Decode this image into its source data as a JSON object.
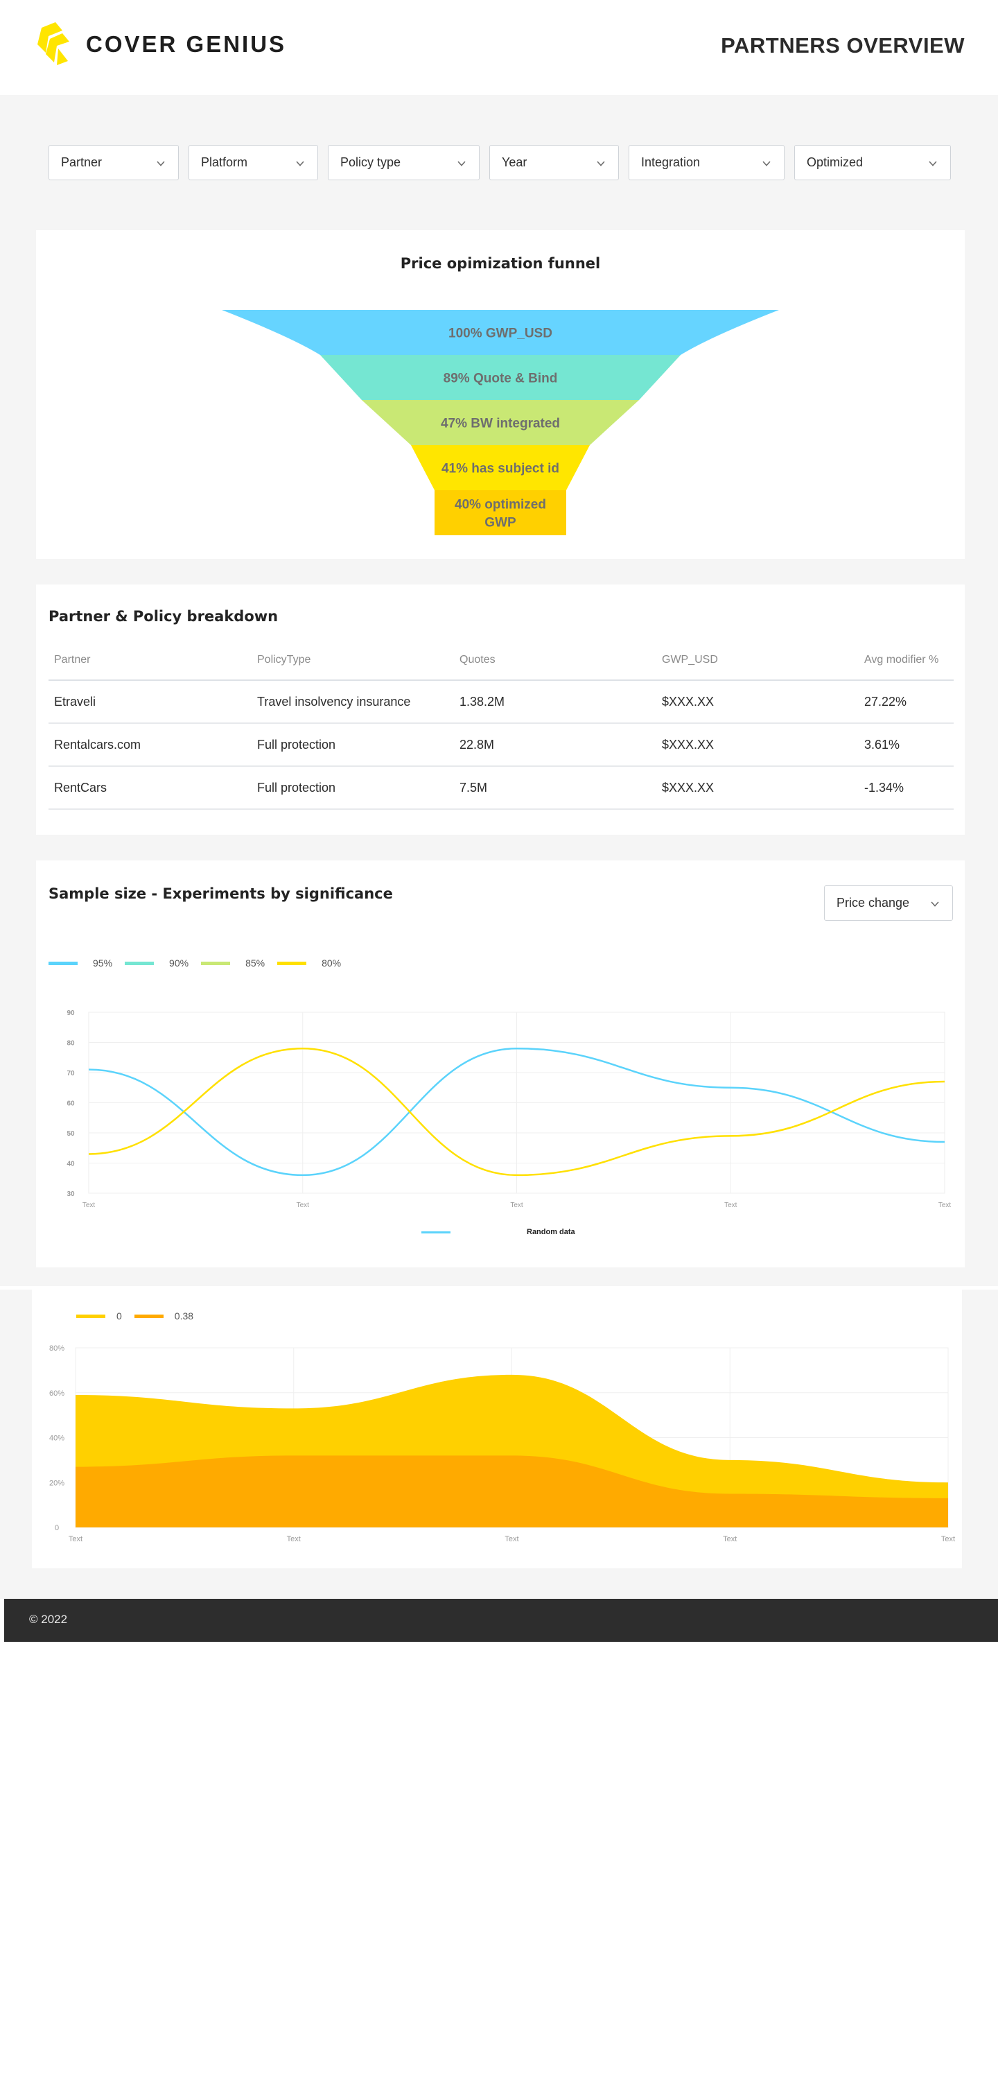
{
  "header": {
    "brand": "COVER GENIUS",
    "title": "PARTNERS OVERVIEW",
    "logo_color": "#ffe500"
  },
  "filters": [
    {
      "label": "Partner",
      "icon": "chevron-down-icon"
    },
    {
      "label": "Platform",
      "icon": "chevron-down-icon"
    },
    {
      "label": "Policy type",
      "icon": "chevron-down-icon"
    },
    {
      "label": "Year",
      "icon": "chevron-down-icon"
    },
    {
      "label": "Integration",
      "icon": "chevron-down-icon"
    },
    {
      "label": "Optimized",
      "icon": "chevron-down-icon"
    }
  ],
  "funnel": {
    "title": "Price opimization funnel",
    "stages": [
      {
        "label": "100% GWP_USD",
        "percent": 100,
        "color": "#66d4ff"
      },
      {
        "label": "89% Quote & Bind",
        "percent": 89,
        "color": "#75e6d2"
      },
      {
        "label": "47% BW integrated",
        "percent": 47,
        "color": "#c9e874"
      },
      {
        "label": "41% has subject id",
        "percent": 41,
        "color": "#ffe600"
      },
      {
        "label": "40% optimized GWP",
        "lines": [
          "40% optimized",
          "GWP"
        ],
        "percent": 40,
        "color": "#ffd000"
      }
    ]
  },
  "breakdown": {
    "title": "Partner & Policy breakdown",
    "columns": [
      "Partner",
      "PolicyType",
      "Quotes",
      "GWP_USD",
      "Avg modifier %"
    ],
    "rows": [
      [
        "Etraveli",
        "Travel insolvency insurance",
        "1.38.2M",
        "$XXX.XX",
        "27.22%"
      ],
      [
        "Rentalcars.com",
        "Full protection",
        "22.8M",
        "$XXX.XX",
        "3.61%"
      ],
      [
        "RentCars",
        "Full protection",
        "7.5M",
        "$XXX.XX",
        "-1.34%"
      ]
    ]
  },
  "significance": {
    "title": "Sample size - Experiments by significance",
    "dropdown": "Price change",
    "legend": [
      {
        "label": "95%",
        "color": "#5bd3fb"
      },
      {
        "label": "90%",
        "color": "#75e6d2"
      },
      {
        "label": "85%",
        "color": "#c9e874"
      },
      {
        "label": "80%",
        "color": "#ffe000"
      }
    ],
    "bottom_legend": {
      "label": "Random data",
      "color": "#5bd3fb"
    }
  },
  "stacked": {
    "legend": [
      {
        "label": "0",
        "color": "#ffd000"
      },
      {
        "label": "0.38",
        "color": "#ffaa00"
      }
    ]
  },
  "chart_data": [
    {
      "type": "line",
      "title": "Sample size - Experiments by significance",
      "categories": [
        "Text",
        "Text",
        "Text",
        "Text",
        "Text"
      ],
      "ylim": [
        30,
        90
      ],
      "yticks": [
        30,
        40,
        50,
        60,
        70,
        80,
        90
      ],
      "grid": true,
      "series": [
        {
          "name": "95%",
          "color": "#5bd3fb",
          "values": [
            71,
            36,
            78,
            65,
            47
          ]
        },
        {
          "name": "80%",
          "color": "#ffe000",
          "values": [
            43,
            78,
            36,
            49,
            67
          ]
        }
      ],
      "legend": "top-left"
    },
    {
      "type": "area",
      "title": "",
      "categories": [
        "Text",
        "Text",
        "Text",
        "Text",
        "Text"
      ],
      "ylim": [
        0,
        80
      ],
      "yticks": [
        "0",
        "20%",
        "40%",
        "60%",
        "80%"
      ],
      "ytick_values": [
        0,
        20,
        40,
        60,
        80
      ],
      "grid": true,
      "series": [
        {
          "name": "0",
          "color": "#ffd000",
          "values": [
            59,
            53,
            68,
            30,
            20
          ]
        },
        {
          "name": "0.38",
          "color": "#ffaa00",
          "values": [
            27,
            32,
            32,
            15,
            13
          ]
        }
      ],
      "legend": "top-left"
    }
  ],
  "footer": {
    "copyright": "© 2022"
  }
}
